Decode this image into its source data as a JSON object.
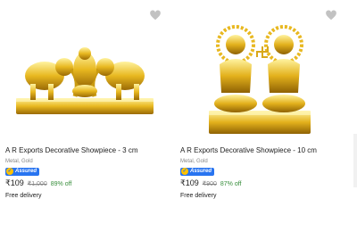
{
  "products": [
    {
      "title": "A R Exports Decorative Showpiece - 3 cm",
      "subtitle": "Metal, Gold",
      "assured": "Assured",
      "price": "₹109",
      "mrp": "₹1,000",
      "discount": "89% off",
      "delivery": "Free delivery"
    },
    {
      "title": "A R Exports Decorative Showpiece - 10 cm",
      "subtitle": "Metal, Gold",
      "assured": "Assured",
      "price": "₹109",
      "mrp": "₹900",
      "discount": "87% off",
      "delivery": "Free delivery"
    }
  ],
  "icons": {
    "wishlist": "heart-icon",
    "assured": "assured-check-icon"
  },
  "colors": {
    "price_discount": "#388e3c",
    "assured_blue": "#2874f0",
    "gold": "#d4a017"
  }
}
